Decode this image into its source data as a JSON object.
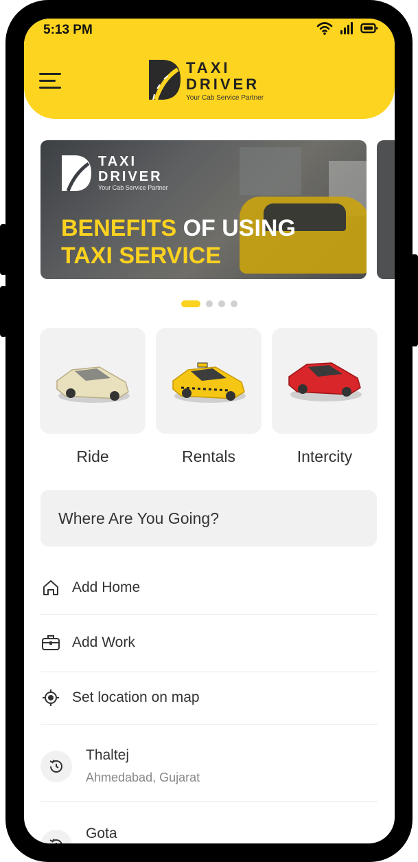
{
  "status_bar": {
    "time": "5:13 PM",
    "wifi_icon": "wifi-icon",
    "signal_icon": "signal-icon",
    "battery_icon": "battery-icon"
  },
  "header": {
    "menu_icon": "hamburger-menu-icon",
    "logo_line1": "TAXI",
    "logo_line2": "DRIVER",
    "logo_tagline": "Your Cab Service Partner",
    "brand_color": "#fdd41f"
  },
  "banner": {
    "logo_line1": "TAXI",
    "logo_line2": "DRIVER",
    "logo_tagline": "Your Cab Service Partner",
    "headline_part1": "BENEFITS",
    "headline_part2": " OF USING",
    "headline_part3": "TAXI SERVICE",
    "pages": 4,
    "active_page": 1
  },
  "services": [
    {
      "label": "Ride",
      "icon": "beige-sedan-icon"
    },
    {
      "label": "Rentals",
      "icon": "yellow-taxi-icon"
    },
    {
      "label": "Intercity",
      "icon": "red-car-icon"
    }
  ],
  "search": {
    "placeholder": "Where Are You Going?"
  },
  "quick_actions": [
    {
      "label": "Add Home",
      "icon": "home-icon"
    },
    {
      "label": "Add Work",
      "icon": "briefcase-icon"
    },
    {
      "label": "Set location on map",
      "icon": "location-target-icon"
    }
  ],
  "recent_locations": [
    {
      "title": "Thaltej",
      "subtitle": "Ahmedabad, Gujarat",
      "icon": "history-icon"
    },
    {
      "title": "Gota",
      "subtitle": "",
      "icon": "history-icon"
    }
  ]
}
